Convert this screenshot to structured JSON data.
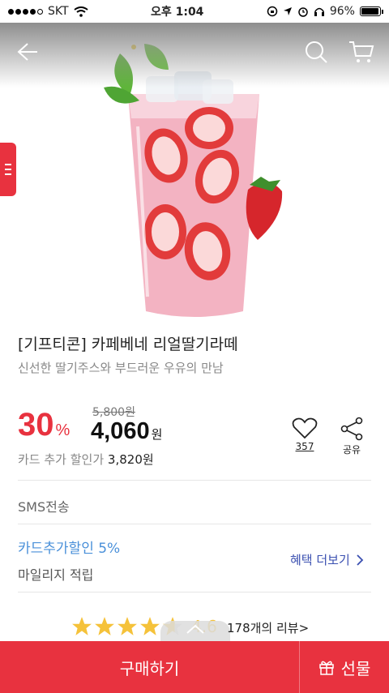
{
  "status_bar": {
    "carrier": "SKT",
    "time": "오후 1:04",
    "battery": "96%"
  },
  "icons": {
    "back": "arrow-left-icon",
    "search": "search-icon",
    "cart": "cart-icon",
    "like": "heart-icon",
    "share": "share-icon",
    "gift": "gift-icon"
  },
  "product": {
    "title": "[기프티콘] 카페베네 리얼딸기라떼",
    "subtitle": "신선한 딸기주스와 부드러운 우유의 만남"
  },
  "price": {
    "discount_value": "30",
    "discount_unit": "%",
    "original": "5,800원",
    "sale_value": "4,060",
    "sale_unit": "원",
    "card_label": "카드 추가 할인가",
    "card_value": "3,820원"
  },
  "actions": {
    "like_count": "357",
    "share_label": "공유"
  },
  "delivery": {
    "method": "SMS전송"
  },
  "benefits": {
    "card_discount": "카드추가할인 5%",
    "mileage": "마일리지 적립",
    "more_link": "혜택 더보기"
  },
  "rating": {
    "score": "4.6",
    "review_link": "178개의 리뷰>"
  },
  "bottom_bar": {
    "buy_label": "구매하기",
    "gift_label": "선물"
  },
  "colors": {
    "accent": "#e8323f",
    "link_blue": "#4a90d9",
    "star": "#f5c23a"
  }
}
